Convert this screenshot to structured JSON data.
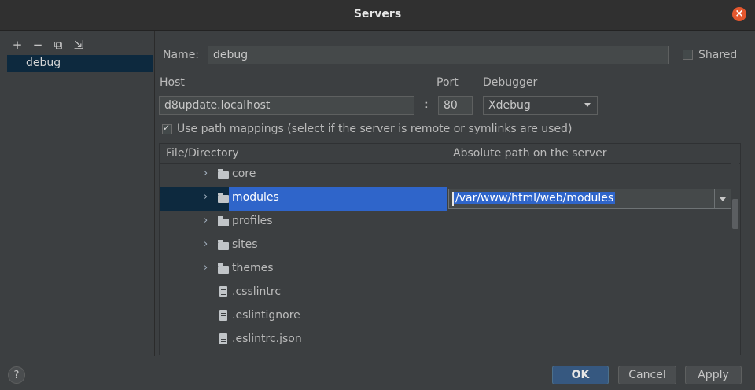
{
  "window": {
    "title": "Servers",
    "close_icon": "close-icon"
  },
  "sidebar": {
    "toolbar": [
      {
        "name": "add-icon",
        "glyph": "+"
      },
      {
        "name": "remove-icon",
        "glyph": "−"
      },
      {
        "name": "copy-icon",
        "glyph": "⧉"
      },
      {
        "name": "import-icon",
        "glyph": "⇲"
      }
    ],
    "items": [
      {
        "label": "debug"
      }
    ]
  },
  "form": {
    "name_label": "Name:",
    "name_value": "debug",
    "shared_label": "Shared",
    "shared_checked": false,
    "host_label": "Host",
    "host_value": "d8update.localhost",
    "port_label": "Port",
    "port_separator": ":",
    "port_value": "80",
    "debugger_label": "Debugger",
    "debugger_value": "Xdebug",
    "path_mappings_label": "Use path mappings (select if the server is remote or symlinks are used)",
    "path_mappings_checked": true
  },
  "table": {
    "headers": {
      "file": "File/Directory",
      "absolute": "Absolute path on the server"
    },
    "rows": [
      {
        "type": "folder",
        "name": "core"
      },
      {
        "type": "folder",
        "name": "modules",
        "selected": true,
        "mapping": "/var/www/html/web/modules"
      },
      {
        "type": "folder",
        "name": "profiles"
      },
      {
        "type": "folder",
        "name": "sites"
      },
      {
        "type": "folder",
        "name": "themes"
      },
      {
        "type": "file",
        "name": ".csslintrc"
      },
      {
        "type": "file",
        "name": ".eslintignore"
      },
      {
        "type": "file",
        "name": ".eslintrc.json"
      }
    ]
  },
  "footer": {
    "help": "?",
    "ok": "OK",
    "cancel": "Cancel",
    "apply": "Apply"
  },
  "colors": {
    "background": "#3c3f41",
    "selection": "#2f65ca",
    "primary_button": "#365880",
    "close": "#e4572e"
  }
}
